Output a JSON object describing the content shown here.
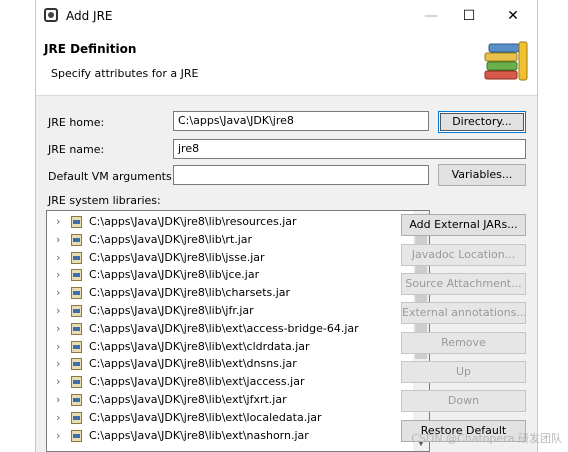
{
  "window": {
    "title": "Add JRE",
    "minimize_label": "—",
    "maximize_label": "☐",
    "close_label": "✕"
  },
  "header": {
    "title": "JRE Definition",
    "subtitle": "Specify attributes for a JRE"
  },
  "form": {
    "jre_home_label": "JRE home:",
    "jre_home_value": "C:\\apps\\Java\\JDK\\jre8",
    "directory_button": "Directory...",
    "jre_name_label": "JRE name:",
    "jre_name_value": "jre8",
    "vm_args_label": "Default VM arguments:",
    "vm_args_value": "",
    "variables_button": "Variables...",
    "libraries_label": "JRE system libraries:"
  },
  "libraries": [
    "C:\\apps\\Java\\JDK\\jre8\\lib\\resources.jar",
    "C:\\apps\\Java\\JDK\\jre8\\lib\\rt.jar",
    "C:\\apps\\Java\\JDK\\jre8\\lib\\jsse.jar",
    "C:\\apps\\Java\\JDK\\jre8\\lib\\jce.jar",
    "C:\\apps\\Java\\JDK\\jre8\\lib\\charsets.jar",
    "C:\\apps\\Java\\JDK\\jre8\\lib\\jfr.jar",
    "C:\\apps\\Java\\JDK\\jre8\\lib\\ext\\access-bridge-64.jar",
    "C:\\apps\\Java\\JDK\\jre8\\lib\\ext\\cldrdata.jar",
    "C:\\apps\\Java\\JDK\\jre8\\lib\\ext\\dnsns.jar",
    "C:\\apps\\Java\\JDK\\jre8\\lib\\ext\\jaccess.jar",
    "C:\\apps\\Java\\JDK\\jre8\\lib\\ext\\jfxrt.jar",
    "C:\\apps\\Java\\JDK\\jre8\\lib\\ext\\localedata.jar",
    "C:\\apps\\Java\\JDK\\jre8\\lib\\ext\\nashorn.jar"
  ],
  "side_buttons": {
    "add_external_jars": "Add External JARs...",
    "javadoc_location": "Javadoc Location...",
    "source_attachment": "Source Attachment...",
    "external_annotations": "External annotations...",
    "remove": "Remove",
    "up": "Up",
    "down": "Down",
    "restore_default": "Restore Default"
  },
  "watermark": "CSDN @Chatopera 研发团队"
}
